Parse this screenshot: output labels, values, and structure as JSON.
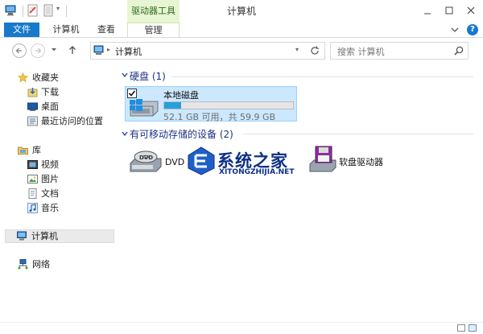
{
  "window": {
    "title": "计算机",
    "context_group": "驱动器工具",
    "controls": [
      "minimize",
      "maximize",
      "close"
    ]
  },
  "ribbon": {
    "tabs": [
      {
        "label": "文件",
        "active": false,
        "style": "file"
      },
      {
        "label": "计算机"
      },
      {
        "label": "查看"
      },
      {
        "label": "管理",
        "context": true
      }
    ],
    "help": "?"
  },
  "address": {
    "path": [
      "计算机"
    ],
    "search_placeholder": "搜索 计算机"
  },
  "nav": {
    "favorites": {
      "label": "收藏夹",
      "items": [
        "下载",
        "桌面",
        "最近访问的位置"
      ]
    },
    "libraries": {
      "label": "库",
      "items": [
        "视频",
        "图片",
        "文档",
        "音乐"
      ]
    },
    "computer": {
      "label": "计算机",
      "selected": true
    },
    "network": {
      "label": "网络"
    }
  },
  "content": {
    "hard_disks": {
      "header": "硬盘 (1)",
      "drives": [
        {
          "name": "本地磁盘",
          "free": "52.1 GB 可用，共 59.9 GB",
          "used_fraction": 0.13,
          "selected": true,
          "checked": true
        }
      ]
    },
    "removable": {
      "header": "有可移动存储的设备 (2)",
      "devices": [
        {
          "name": "DVD 驱动器",
          "icon": "dvd-drive-icon"
        },
        {
          "name": "软盘驱动器",
          "icon": "floppy-drive-icon"
        }
      ]
    }
  },
  "watermark": {
    "brand": "系统之家",
    "domain": "XITONGZHIJIA.NET"
  },
  "colors": {
    "accent": "#1979ca",
    "selection": "#cce8ff",
    "progress": "#26a0da",
    "group_header": "#1e3287",
    "context_tab": "#e8f5d3"
  }
}
